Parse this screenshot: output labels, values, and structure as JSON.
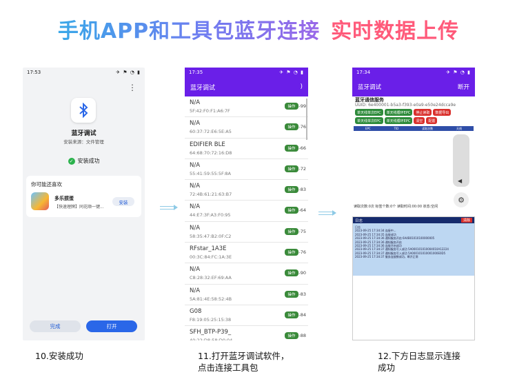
{
  "title": {
    "part1": "手机APP和工具包蓝牙连接",
    "part2": "实时数据上传"
  },
  "phone1": {
    "status_time": "17:53",
    "status_icons": "✈ ⚑ ◔ ▮",
    "menu": "⋮",
    "app_name": "蓝牙调试",
    "source": "安装来源：文件管理",
    "success": "安装成功",
    "rec_title": "你可能还喜欢",
    "game_name": "多乐掼蛋",
    "game_desc": "【快速理牌】同花顺一键...",
    "install_label": "安装",
    "done_label": "完成",
    "open_label": "打开"
  },
  "phone2": {
    "status_time": "17:35",
    "status_icons": "✈ ⚑ ◔ ▮",
    "title": "蓝牙调试",
    "refresh": ")",
    "op_label": "操作",
    "devices": [
      {
        "name": "N/A",
        "addr": "5F:42:F0:F1:A6:7F",
        "rssi": "-99"
      },
      {
        "name": "N/A",
        "addr": "60:37:72:E6:5E:A5",
        "rssi": "-76"
      },
      {
        "name": "EDIFIER BLE",
        "addr": "64:68:70:72:16:D8",
        "rssi": "-66"
      },
      {
        "name": "N/A",
        "addr": "55:41:59:55:5F:8A",
        "rssi": "-72"
      },
      {
        "name": "N/A",
        "addr": "72:4B:61:21:63:B7",
        "rssi": "-83"
      },
      {
        "name": "N/A",
        "addr": "44:E7:3F:A3:F0:95",
        "rssi": "-64"
      },
      {
        "name": "N/A",
        "addr": "58:35:47:B2:0F:C2",
        "rssi": "-75"
      },
      {
        "name": "RFstar_1A3E",
        "addr": "00:3C:84:FC:1A:3E",
        "rssi": "-76"
      },
      {
        "name": "N/A",
        "addr": "C8:28:32:EF:69:AA",
        "rssi": "-90"
      },
      {
        "name": "N/A",
        "addr": "5A:81:4E:58:52:4B",
        "rssi": "-83"
      },
      {
        "name": "G08",
        "addr": "F8:19:05:25:15:38",
        "rssi": "-84"
      },
      {
        "name": "SFH_BTP-P39_",
        "addr": "40:22:D8:58:D0:04",
        "rssi": "-88"
      }
    ]
  },
  "phone3": {
    "status_time": "17:34",
    "status_icons": "✈ ⚑ ◔ ▮",
    "title": "蓝牙调试",
    "disconnect": "断开",
    "service": "蓝牙通信服务",
    "uuid": "UUID: 6e400001-b5a3-f393-e0a9-e50e24dcca9e",
    "buttons": [
      {
        "label": "单天线单次EPC",
        "color": "g"
      },
      {
        "label": "单天线循环EPC",
        "color": "g"
      },
      {
        "label": "停止读取",
        "color": "r"
      },
      {
        "label": "数据导出",
        "color": "r"
      },
      {
        "label": "单天线单次EPC",
        "color": "g"
      },
      {
        "label": "单天线循环EPC",
        "color": "g"
      },
      {
        "label": "清空",
        "color": "r"
      },
      {
        "label": "配置",
        "color": "r"
      }
    ],
    "table_headers": [
      "EPC",
      "TID",
      "读取次数",
      "天线"
    ],
    "volume_icon": "◀",
    "gear_icon": "⚙",
    "status_line": "读取次数:0次   标签个数:0个   读取时间:00:00   状态:空闲"
  },
  "log": {
    "title": "日志",
    "clear": "清除",
    "lines": [
      "日志",
      "2023-09-25 17:34:34  连接中...",
      "2023-09-25 17:34:35  连接成功",
      "2023-09-25 17:34:36  通知服务开启 6A4B01010100000005",
      "2023-09-25 17:34:36  通知服务开启",
      "2023-09-25 17:34:36  连接开启成功",
      "2023-09-25 17:34:37  通知服务写入成功 5A000101010004010A12224",
      "2023-09-25 17:34:37  通知服务写入成功 5A000101010001000E0D5",
      "2023-09-25 17:34:37  服务连接数成功，断开正常"
    ]
  },
  "captions": {
    "c1": "10.安装成功",
    "c2a": "11.打开蓝牙调试软件，",
    "c2b": "点击连接工具包",
    "c3a": "12.下方日志显示连接",
    "c3b": "成功"
  },
  "colors": {
    "purple": "#6a1fe8",
    "green": "#2e8b3b",
    "red": "#d9302c",
    "blue": "#2a67e8"
  }
}
